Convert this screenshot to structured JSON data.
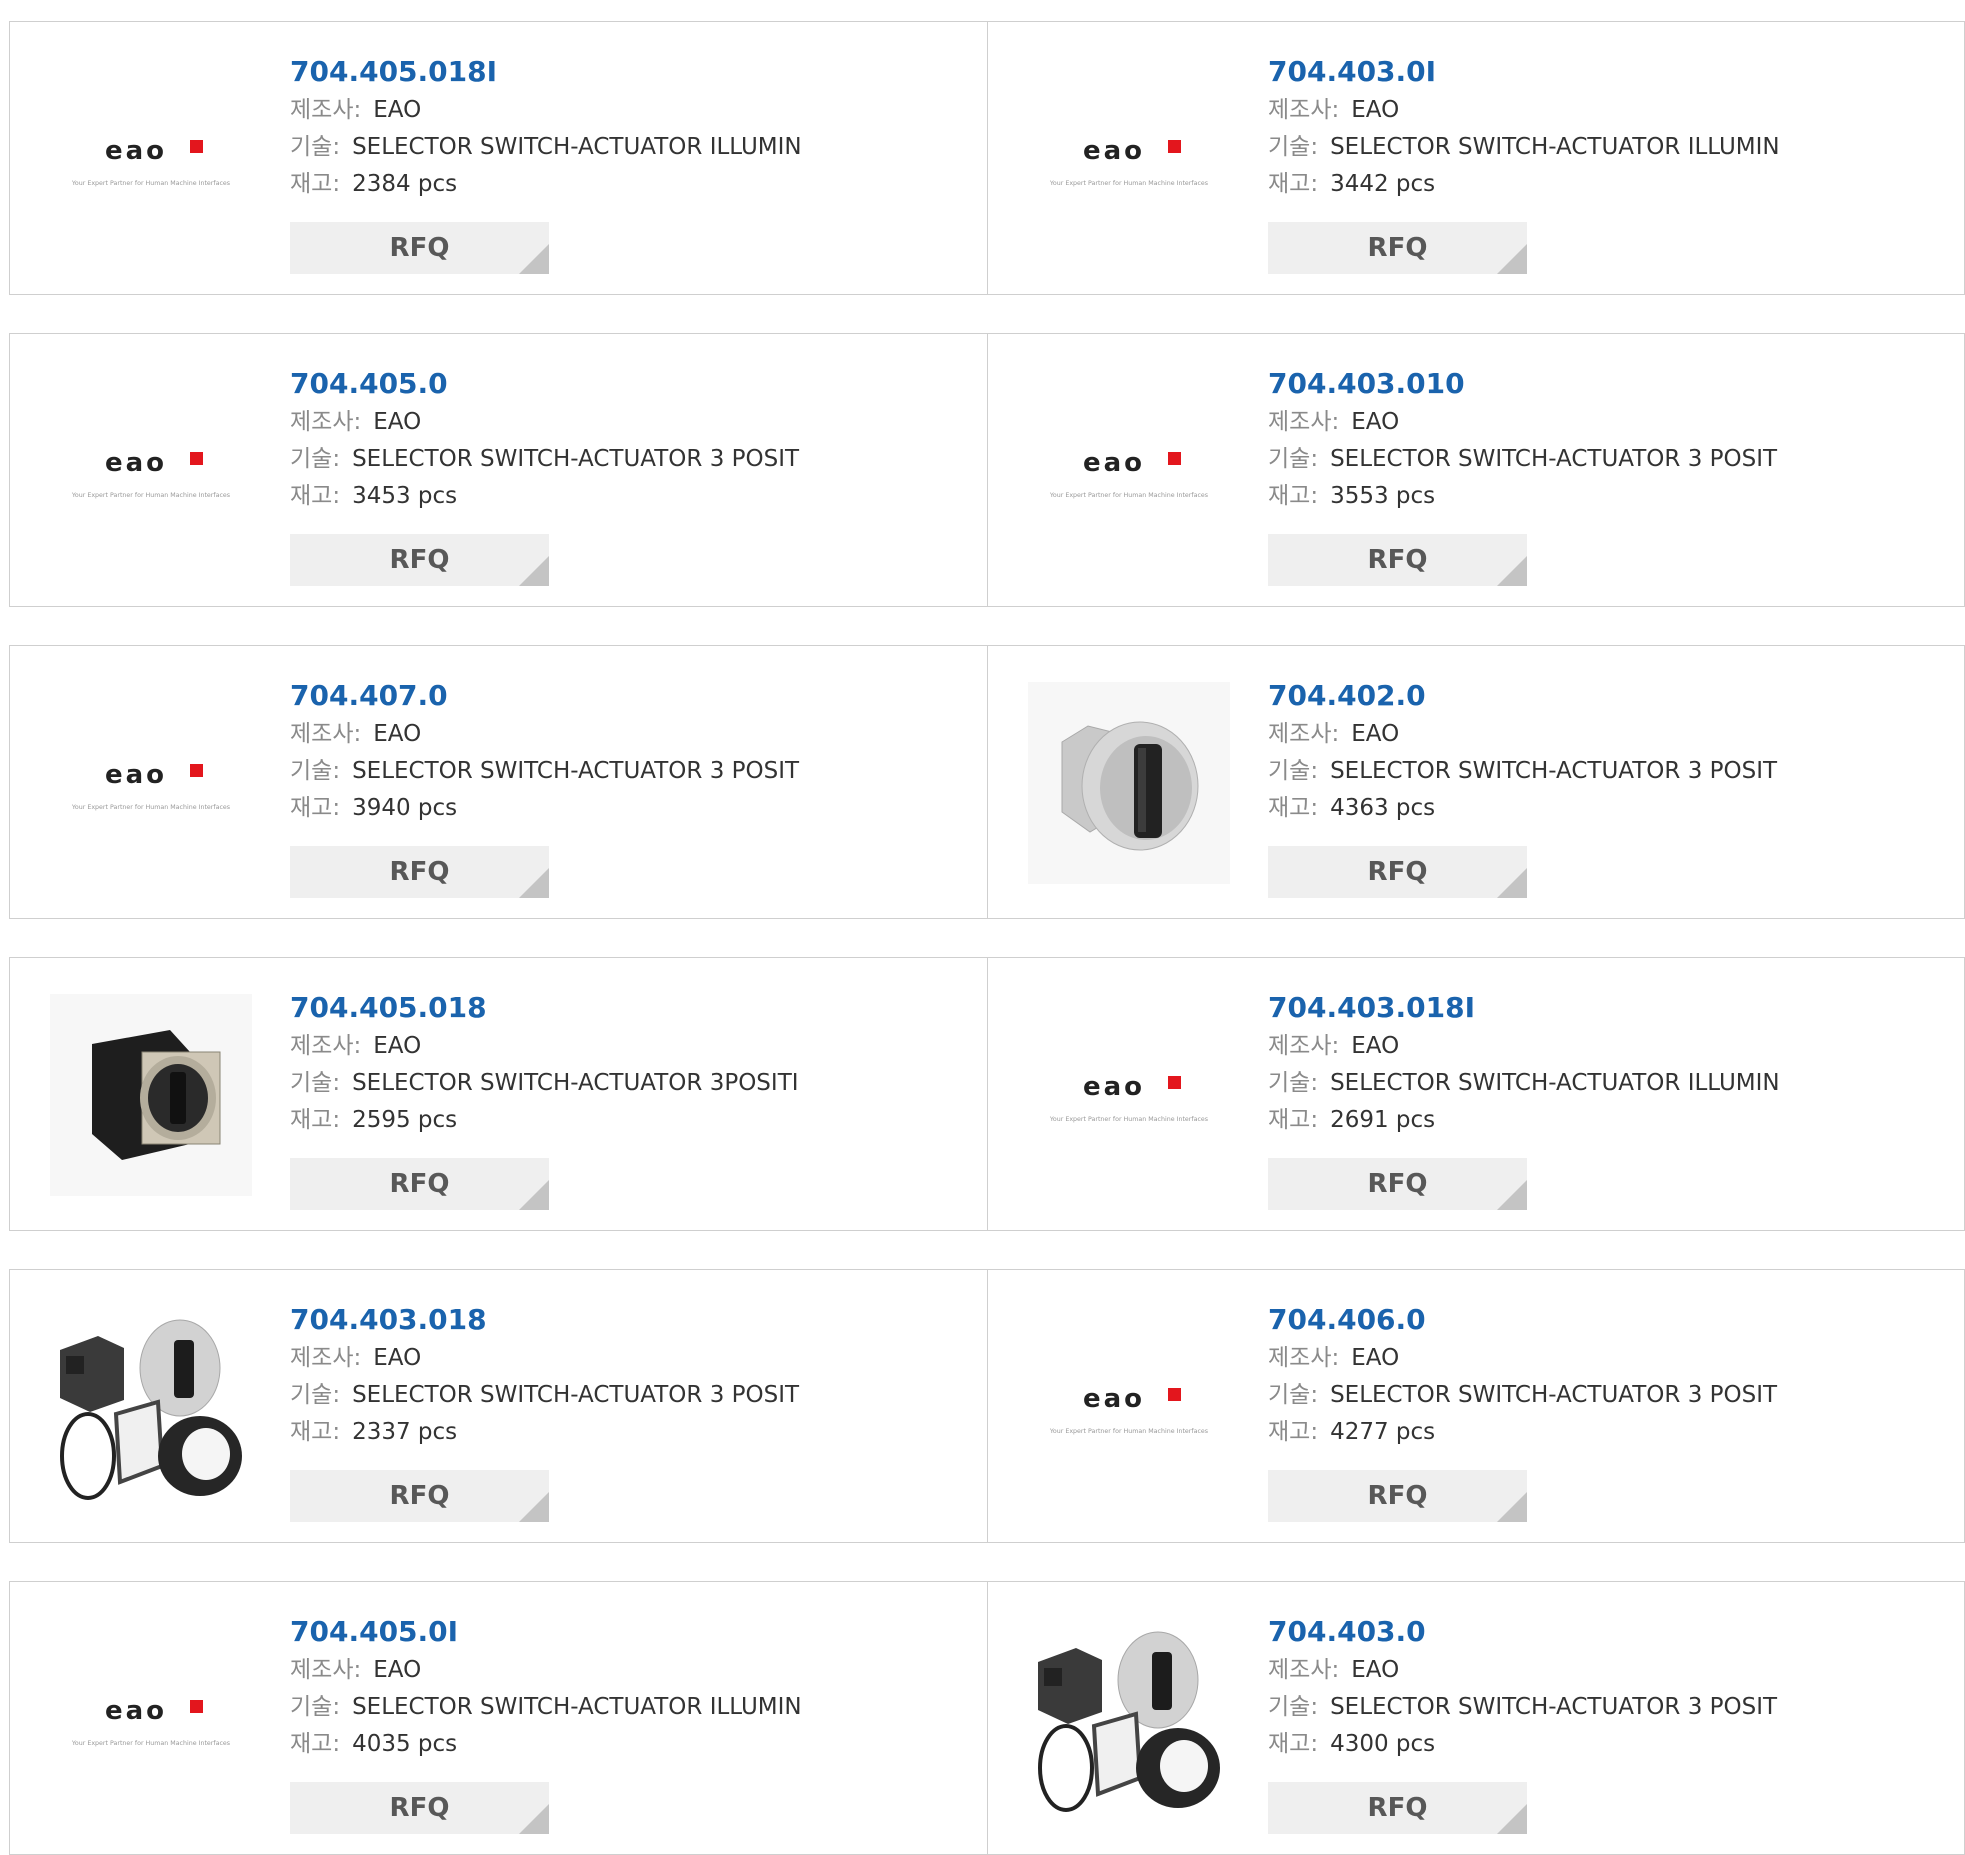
{
  "labels": {
    "manufacturer": "제조사:",
    "description": "기술:",
    "stock": "재고:"
  },
  "brand_logo": {
    "wordmark": "eao",
    "tagline": "Your Expert Partner for Human Machine Interfaces",
    "accent_color": "#e3161d"
  },
  "colors": {
    "part_link": "#1a63ad",
    "rfq_bg": "#efefef",
    "rfq_text": "#585858",
    "border": "#cfcfcf"
  },
  "products": [
    {
      "part": "704.405.018I",
      "manufacturer": "EAO",
      "description": "SELECTOR SWITCH-ACTUATOR ILLUMIN",
      "stock": "2384 pcs",
      "rfq": "RFQ",
      "image": "eao-logo"
    },
    {
      "part": "704.403.0I",
      "manufacturer": "EAO",
      "description": "SELECTOR SWITCH-ACTUATOR ILLUMIN",
      "stock": "3442 pcs",
      "rfq": "RFQ",
      "image": "eao-logo"
    },
    {
      "part": "704.405.0",
      "manufacturer": "EAO",
      "description": "SELECTOR SWITCH-ACTUATOR 3 POSIT",
      "stock": "3453 pcs",
      "rfq": "RFQ",
      "image": "eao-logo"
    },
    {
      "part": "704.403.010",
      "manufacturer": "EAO",
      "description": "SELECTOR SWITCH-ACTUATOR 3 POSIT",
      "stock": "3553 pcs",
      "rfq": "RFQ",
      "image": "eao-logo"
    },
    {
      "part": "704.407.0",
      "manufacturer": "EAO",
      "description": "SELECTOR SWITCH-ACTUATOR 3 POSIT",
      "stock": "3940 pcs",
      "rfq": "RFQ",
      "image": "eao-logo"
    },
    {
      "part": "704.402.0",
      "manufacturer": "EAO",
      "description": "SELECTOR SWITCH-ACTUATOR 3 POSIT",
      "stock": "4363 pcs",
      "rfq": "RFQ",
      "image": "gray-selector-switch"
    },
    {
      "part": "704.405.018",
      "manufacturer": "EAO",
      "description": "SELECTOR SWITCH-ACTUATOR 3POSITI",
      "stock": "2595 pcs",
      "rfq": "RFQ",
      "image": "black-selector-switch"
    },
    {
      "part": "704.403.018I",
      "manufacturer": "EAO",
      "description": "SELECTOR SWITCH-ACTUATOR ILLUMIN",
      "stock": "2691 pcs",
      "rfq": "RFQ",
      "image": "eao-logo"
    },
    {
      "part": "704.403.018",
      "manufacturer": "EAO",
      "description": "SELECTOR SWITCH-ACTUATOR 3 POSIT",
      "stock": "2337 pcs",
      "rfq": "RFQ",
      "image": "selector-switch-kit"
    },
    {
      "part": "704.406.0",
      "manufacturer": "EAO",
      "description": "SELECTOR SWITCH-ACTUATOR 3 POSIT",
      "stock": "4277 pcs",
      "rfq": "RFQ",
      "image": "eao-logo"
    },
    {
      "part": "704.405.0I",
      "manufacturer": "EAO",
      "description": "SELECTOR SWITCH-ACTUATOR ILLUMIN",
      "stock": "4035 pcs",
      "rfq": "RFQ",
      "image": "eao-logo"
    },
    {
      "part": "704.403.0",
      "manufacturer": "EAO",
      "description": "SELECTOR SWITCH-ACTUATOR 3 POSIT",
      "stock": "4300 pcs",
      "rfq": "RFQ",
      "image": "selector-switch-kit"
    }
  ]
}
